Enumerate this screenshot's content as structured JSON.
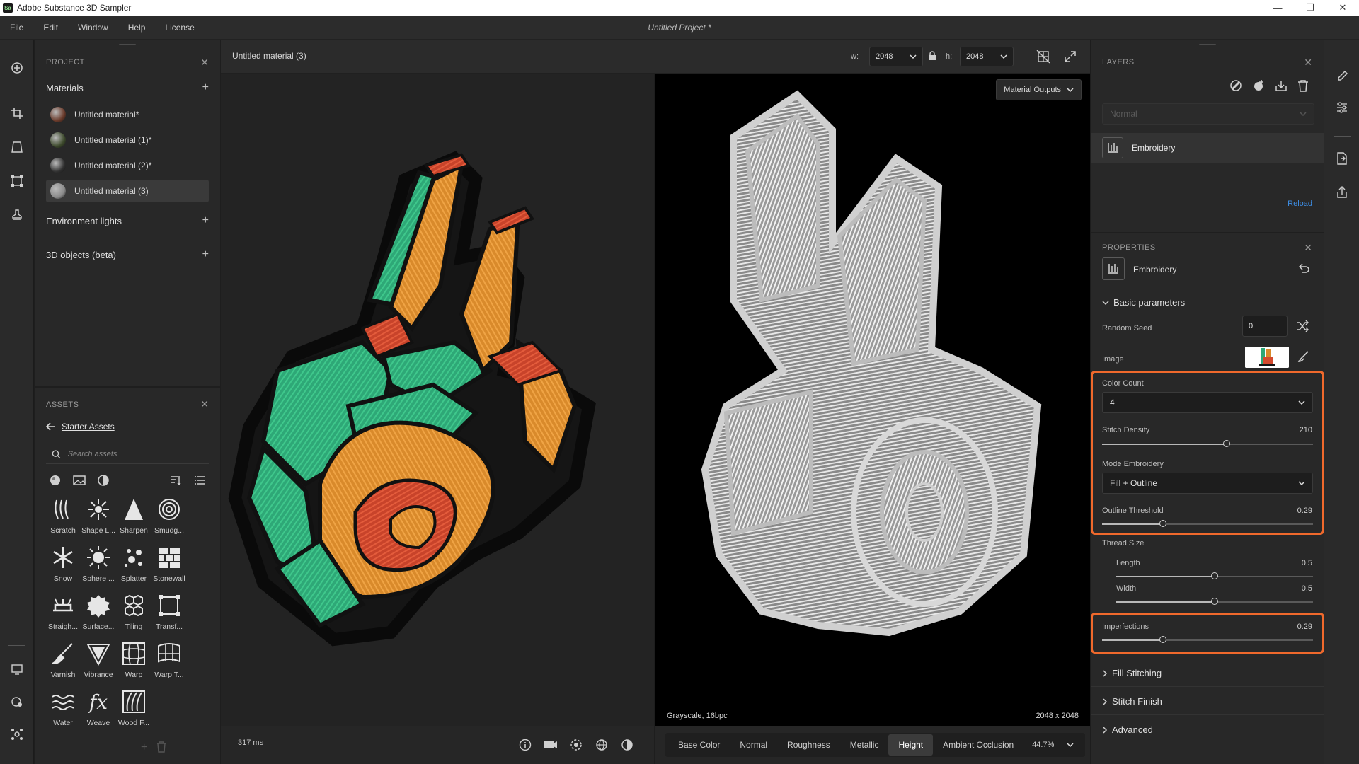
{
  "window": {
    "title": "Adobe Substance 3D Sampler",
    "app_icon_text": "Sa",
    "minimize": "—",
    "maximize": "❐",
    "close": "✕"
  },
  "menu": {
    "items": [
      "File",
      "Edit",
      "Window",
      "Help",
      "License"
    ],
    "project_title": "Untitled Project *"
  },
  "project": {
    "header": "PROJECT",
    "materials_label": "Materials",
    "materials": [
      {
        "label": "Untitled material*",
        "thumb": "#6a3a2a"
      },
      {
        "label": "Untitled material (1)*",
        "thumb": "#3d4a2c"
      },
      {
        "label": "Untitled material (2)*",
        "thumb": "#303030"
      },
      {
        "label": "Untitled material (3)",
        "thumb": "#8a8a8a"
      }
    ],
    "env_label": "Environment lights",
    "objects_label": "3D objects (beta)",
    "plus": "+",
    "close": "✕"
  },
  "assets": {
    "header": "ASSETS",
    "back_label": "Starter Assets",
    "search_placeholder": "Search assets",
    "items": [
      "Scratch",
      "Shape L...",
      "Sharpen",
      "Smudg...",
      "Snow",
      "Sphere ...",
      "Splatter",
      "Stonewall",
      "Straigh...",
      "Surface...",
      "Tiling",
      "Transf...",
      "Varnish",
      "Vibrance",
      "Warp",
      "Warp T...",
      "Water",
      "Weave",
      "Wood F..."
    ],
    "fx_glyph": "fx"
  },
  "viewport": {
    "breadcrumb": "Untitled material (3)",
    "w_label": "w:",
    "h_label": "h:",
    "width_value": "2048",
    "height_value": "2048",
    "material_outputs": "Material Outputs",
    "left_caption": "Grayscale, 16bpc",
    "right_caption": "2048 x 2048",
    "render_time": "317 ms",
    "channel_tabs": [
      "Base Color",
      "Normal",
      "Roughness",
      "Metallic",
      "Height",
      "Ambient Occlusion"
    ],
    "active_tab": "Height",
    "zoom": "44.7%"
  },
  "layers": {
    "header": "LAYERS",
    "blend_mode": "Normal",
    "layer_name": "Embroidery",
    "reload": "Reload",
    "close": "✕"
  },
  "properties": {
    "header": "PROPERTIES",
    "layer_name": "Embroidery",
    "basic_parameters": "Basic parameters",
    "random_seed_label": "Random Seed",
    "random_seed_value": "0",
    "image_label": "Image",
    "color_count_label": "Color Count",
    "color_count_value": "4",
    "stitch_density_label": "Stitch Density",
    "stitch_density_value": "210",
    "stitch_density_fraction": 0.59,
    "mode_label": "Mode Embroidery",
    "mode_value": "Fill + Outline",
    "outline_threshold_label": "Outline Threshold",
    "outline_threshold_value": "0.29",
    "outline_threshold_fraction": 0.29,
    "thread_size_label": "Thread Size",
    "length_label": "Length",
    "length_value": "0.5",
    "length_fraction": 0.5,
    "width_label": "Width",
    "width_value": "0.5",
    "width_fraction": 0.5,
    "imperfections_label": "Imperfections",
    "imperfections_value": "0.29",
    "imperfections_fraction": 0.29,
    "sections": [
      "Fill Stitching",
      "Stitch Finish",
      "Advanced"
    ],
    "highlight_color": "#f0692c"
  },
  "colors": {
    "embroidery_green": "#2ea877",
    "embroidery_orange": "#d98a2b",
    "embroidery_red": "#d44a2e",
    "embroidery_black": "#151515"
  }
}
